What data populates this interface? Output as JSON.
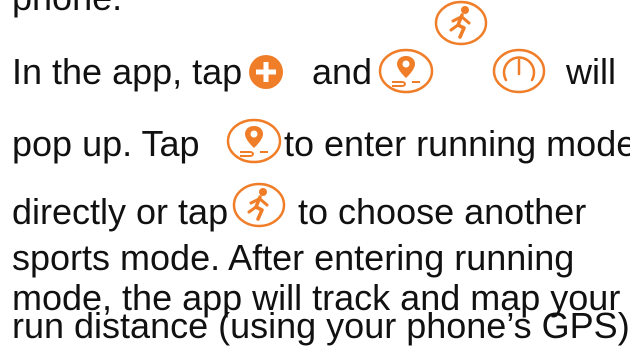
{
  "lines": {
    "clipped": "phone.",
    "l1_a": "In the app, tap",
    "l1_b": "and",
    "l1_c": "will",
    "l2_a": "pop up.  Tap",
    "l2_b": "to enter running mode",
    "l3_a": "directly or tap",
    "l3_b": "to choose another",
    "l4": "sports mode. After entering running",
    "l5": "mode, the app will track and map your",
    "l6": "run distance (using your phone’s GPS)."
  },
  "icons": {
    "plus": "plus-circle-icon",
    "location": "location-route-icon",
    "running": "running-figure-icon",
    "gauge": "speed-gauge-icon"
  },
  "colors": {
    "accent": "#f07d28",
    "text": "#111111"
  }
}
